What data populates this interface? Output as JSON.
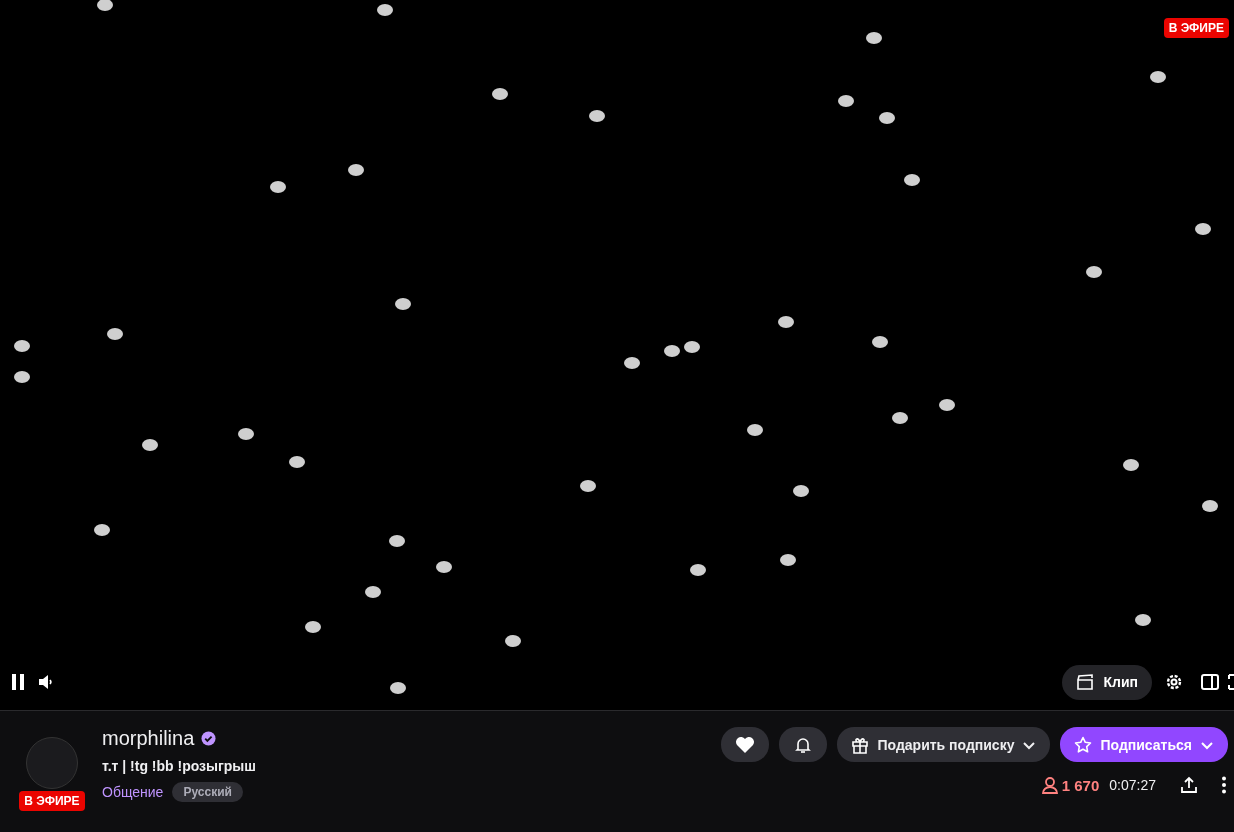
{
  "player": {
    "live_badge": "В ЭФИРЕ",
    "clip_button": "Клип"
  },
  "channel": {
    "name": "morphilina",
    "verified": true,
    "live_badge": "В ЭФИРЕ",
    "title": "т.т | !tg !bb !розыгрыш",
    "category": "Общение",
    "tags": [
      "Русский"
    ]
  },
  "actions": {
    "gift_button": "Подарить подписку",
    "subscribe_button": "Подписаться"
  },
  "stats": {
    "viewers": "1 670",
    "uptime": "0:07:27"
  }
}
